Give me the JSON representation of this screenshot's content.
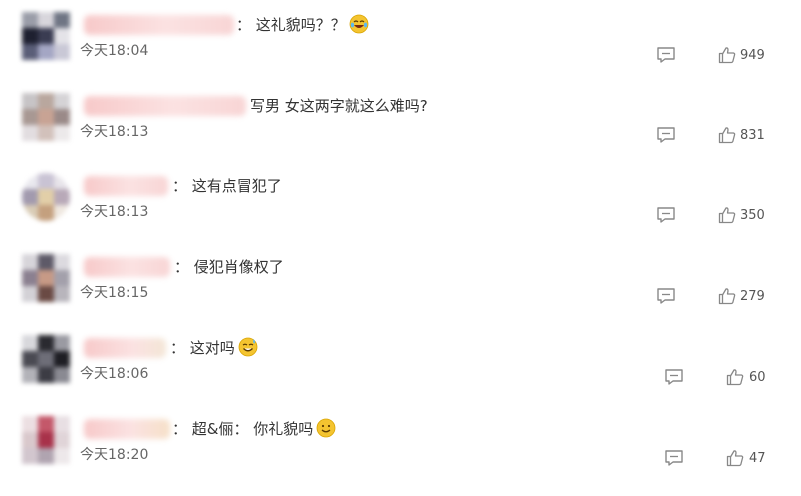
{
  "comments": [
    {
      "text": "： 这礼貌吗？？",
      "emoji": "cry-laugh-emoji-icon",
      "time": "今天18:04",
      "likes": "949"
    },
    {
      "text": "写男 女这两字就这么难吗?",
      "emoji": "",
      "time": "今天18:13",
      "likes": "831"
    },
    {
      "text": "： 这有点冒犯了",
      "emoji": "",
      "time": "今天18:13",
      "likes": "350"
    },
    {
      "text": "： 侵犯肖像权了",
      "emoji": "",
      "time": "今天18:15",
      "likes": "279"
    },
    {
      "text": "： 这对吗",
      "emoji": "sweat-smile-emoji-icon",
      "time": "今天18:06",
      "likes": "60"
    },
    {
      "text": "： 超&俪： 你礼貌吗",
      "emoji": "smile-emoji-icon",
      "time": "今天18:20",
      "likes": "47"
    }
  ],
  "colors": {
    "text": "#333333",
    "time": "#666666",
    "icon": "#888888",
    "emoji": "#f4c430"
  }
}
